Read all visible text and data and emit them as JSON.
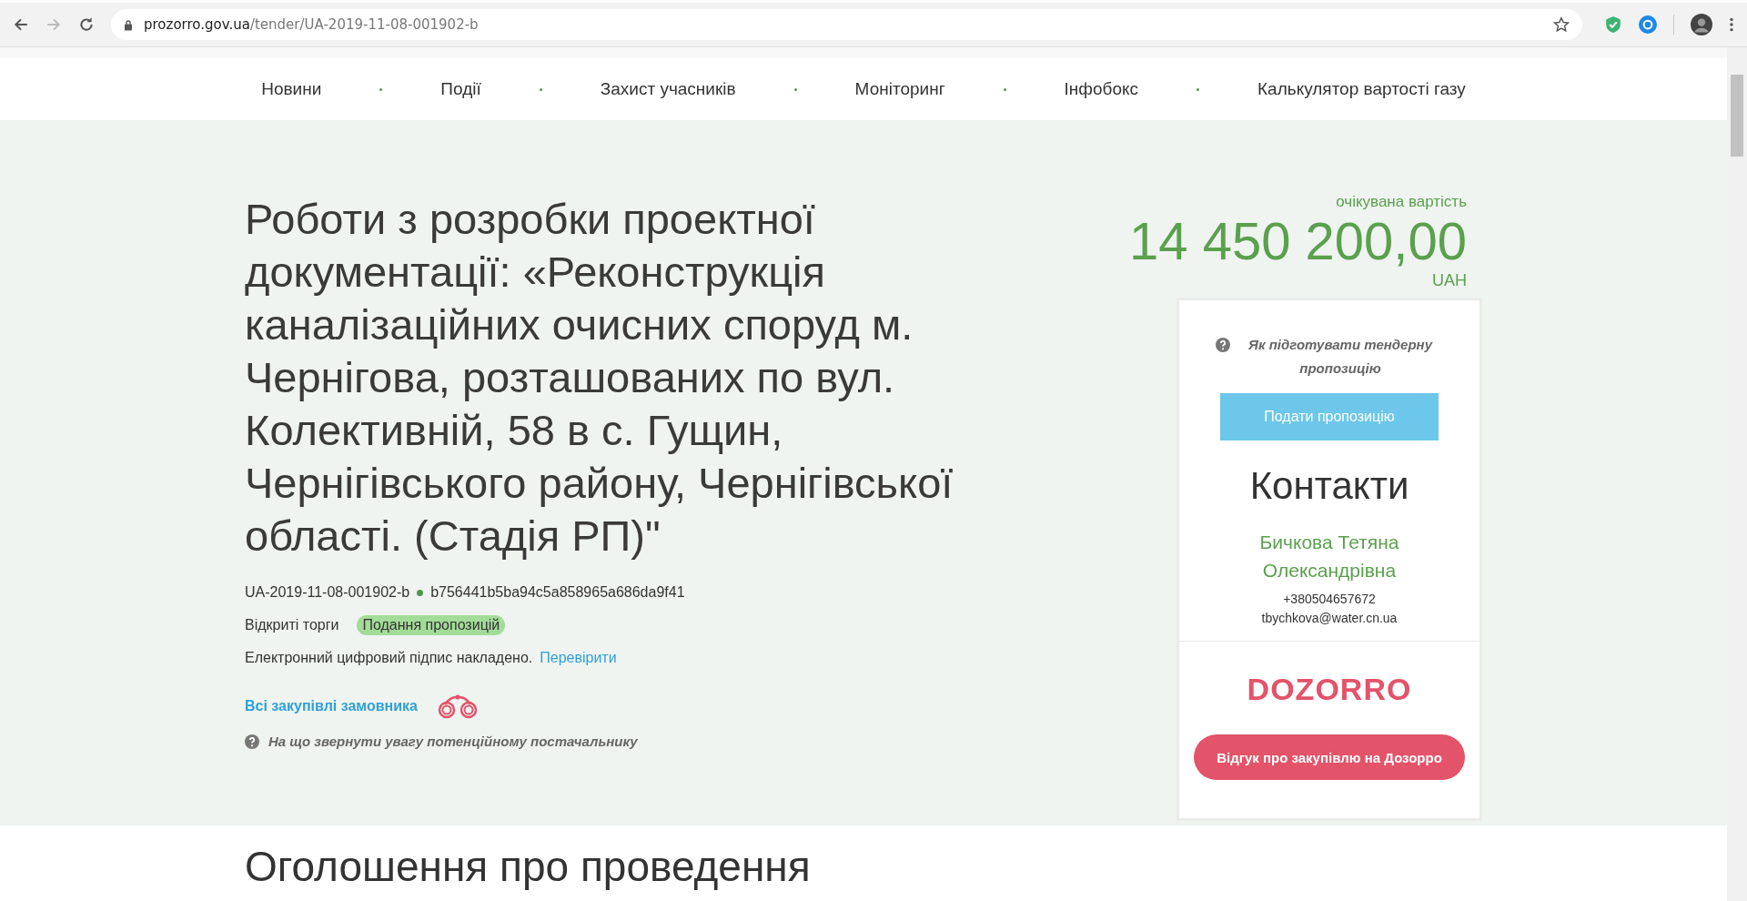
{
  "browser": {
    "url_domain": "prozorro.gov.ua",
    "url_path": "/tender/UA-2019-11-08-001902-b"
  },
  "nav": [
    {
      "label": "Новини"
    },
    {
      "label": "Події"
    },
    {
      "label": "Захист учасників"
    },
    {
      "label": "Моніторинг"
    },
    {
      "label": "Інфобокс"
    },
    {
      "label": "Калькулятор вартості газу"
    }
  ],
  "tender": {
    "title": "Роботи з розробки проектної документації: «Реконструкція каналізаційних очисних споруд м. Чернігова, розташованих по вул. Колективній, 58 в с. Гущин, Чернігівського району, Чернігівської області. (Стадія РП)\"",
    "id": "UA-2019-11-08-001902-b",
    "hash": "b756441b5ba94c5a858965a686da9f41",
    "procedure": "Відкриті торги",
    "status": "Подання пропозицій",
    "signature_text": "Електронний цифровий підпис накладено.",
    "signature_link": "Перевірити",
    "buyer_link": "Всі закупівлі замовника",
    "hint": "На що звернути увагу потенційному постачальнику"
  },
  "value": {
    "label": "очікувана вартість",
    "amount": "14 450 200,00",
    "currency": "UAH"
  },
  "card": {
    "help": "Як підготувати тендерну пропозицію",
    "submit": "Подати пропозицію",
    "contacts_title": "Контакти",
    "name": "Бичкова Тетяна Олександрівна",
    "phone": "+380504657672",
    "email": "tbychkova@water.cn.ua",
    "logo": "DOZORRO",
    "feedback": "Відгук про закупівлю на Дозорро"
  },
  "section_title": "Оголошення про проведення"
}
